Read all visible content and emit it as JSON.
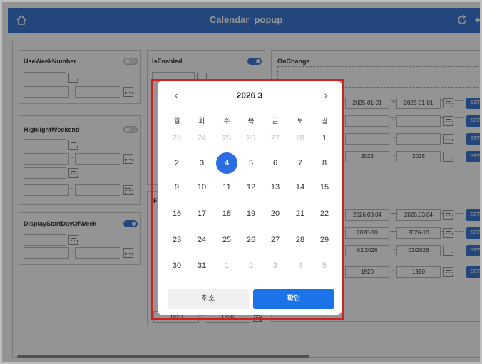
{
  "header": {
    "title": "Calendar_popup"
  },
  "panels": {
    "useweeknumber": {
      "label": "UseWeekNumber",
      "toggle": "off"
    },
    "highlightweekend": {
      "label": "HighlightWeekend",
      "toggle": "off"
    },
    "displaystart": {
      "label": "DisplayStartDayOfWeek",
      "toggle": "on"
    },
    "isenabled": {
      "label": "IsEnabled",
      "toggle": "on"
    },
    "onchange": {
      "label": "OnChange"
    }
  },
  "right_rows": [
    {
      "from": "2025-01-01",
      "to": "2025-01-01",
      "set": "SET"
    },
    {
      "from": "",
      "to": "",
      "set": "SET"
    },
    {
      "from": "",
      "to": "",
      "set": "SET"
    },
    {
      "from": "2025",
      "to": "2025",
      "set": "SET"
    },
    {
      "from": "2026.03.04",
      "to": "2026.03.04",
      "set": "SET"
    },
    {
      "from": "2026-10",
      "to": "2026-10",
      "set": "SET"
    },
    {
      "from": "03/2026",
      "to": "03/2026",
      "set": "SET"
    },
    {
      "from": "1920",
      "to": "1920",
      "set": "SET"
    }
  ],
  "dash": "~",
  "misc": {
    "bottom_from": "1920",
    "bottom_to": "1920",
    "f_label": "F"
  },
  "popup": {
    "title": "2026 3",
    "prev": "‹",
    "next": "›",
    "weekdays": [
      "월",
      "화",
      "수",
      "목",
      "금",
      "토",
      "일"
    ],
    "weeks": [
      [
        "23",
        "24",
        "25",
        "26",
        "27",
        "28",
        "1"
      ],
      [
        "2",
        "3",
        "4",
        "5",
        "6",
        "7",
        "8"
      ],
      [
        "9",
        "10",
        "11",
        "12",
        "13",
        "14",
        "15"
      ],
      [
        "16",
        "17",
        "18",
        "19",
        "20",
        "21",
        "22"
      ],
      [
        "23",
        "24",
        "25",
        "26",
        "27",
        "28",
        "29"
      ],
      [
        "30",
        "31",
        "1",
        "2",
        "3",
        "4",
        "5"
      ]
    ],
    "selected": "4",
    "cancel": "취소",
    "ok": "확인"
  }
}
